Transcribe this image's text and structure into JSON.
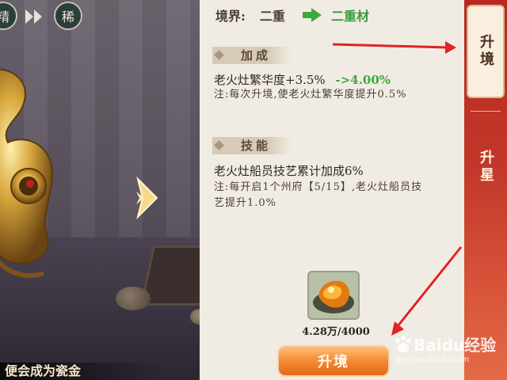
{
  "header": {
    "realm_label": "境界:",
    "realm_from": "二重",
    "realm_to": "二重材"
  },
  "rarity_badges": [
    {
      "text": "精"
    },
    {
      "text": "稀"
    }
  ],
  "bonus_section": {
    "title": "加成",
    "stat_line": "老火灶繁华度+3.5%",
    "stat_arrow": "->",
    "stat_new": "4.00%",
    "note": "注:每次升境,使老火灶繁华度提升0.5%"
  },
  "skill_section": {
    "title": "技能",
    "skill_line": "老火灶船员技艺累计加成6%",
    "note": "注:每开启1个州府【5/15】,老火灶船员技艺提升1.0%"
  },
  "material": {
    "count": "4.28万/4000",
    "icon": "amber-stone-icon"
  },
  "upgrade_button": "升境",
  "side_tabs": [
    {
      "label": "升境",
      "active": true
    },
    {
      "label": "升星",
      "active": false
    }
  ],
  "caption": "便会成为瓷金",
  "watermark": {
    "brand": "Baidu经验",
    "url": "jingyan.baidu.com"
  },
  "colors": {
    "accent_green": "#3ea83f",
    "button_orange": "#f48a32",
    "tab_red": "#c3382a",
    "annotation_red": "#e02323"
  }
}
